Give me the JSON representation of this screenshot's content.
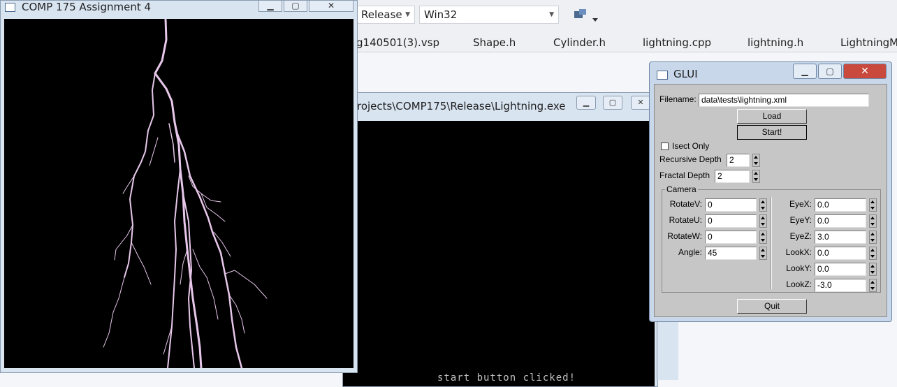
{
  "vs": {
    "config": "Release",
    "platform": "Win32",
    "tabs": [
      "g140501(3).vsp",
      "Shape.h",
      "Cylinder.h",
      "lightning.cpp",
      "lightning.h",
      "LightningMa"
    ]
  },
  "console": {
    "title": "rojects\\COMP175\\Release\\Lightning.exe",
    "output_line": "start button clicked!"
  },
  "lightning_window": {
    "title": "COMP 175 Assignment 4",
    "bolt_color": "#e7c7ea"
  },
  "glui": {
    "title": "GLUI",
    "filename_label": "Filename:",
    "filename_value": "data\\tests\\lightning.xml",
    "load_label": "Load",
    "start_label": "Start!",
    "isect_label": "Isect Only",
    "recursive_depth_label": "Recursive Depth",
    "recursive_depth_value": "2",
    "fractal_depth_label": "Fractal Depth",
    "fractal_depth_value": "2",
    "camera_label": "Camera",
    "camera_left": [
      {
        "label": "RotateV:",
        "value": "0"
      },
      {
        "label": "RotateU:",
        "value": "0"
      },
      {
        "label": "RotateW:",
        "value": "0"
      },
      {
        "label": "Angle:",
        "value": "45"
      }
    ],
    "camera_right": [
      {
        "label": "EyeX:",
        "value": "0.0"
      },
      {
        "label": "EyeY:",
        "value": "0.0"
      },
      {
        "label": "EyeZ:",
        "value": "3.0"
      },
      {
        "label": "LookX:",
        "value": "0.0"
      },
      {
        "label": "LookY:",
        "value": "0.0"
      },
      {
        "label": "LookZ:",
        "value": "-3.0"
      }
    ],
    "quit_label": "Quit"
  }
}
